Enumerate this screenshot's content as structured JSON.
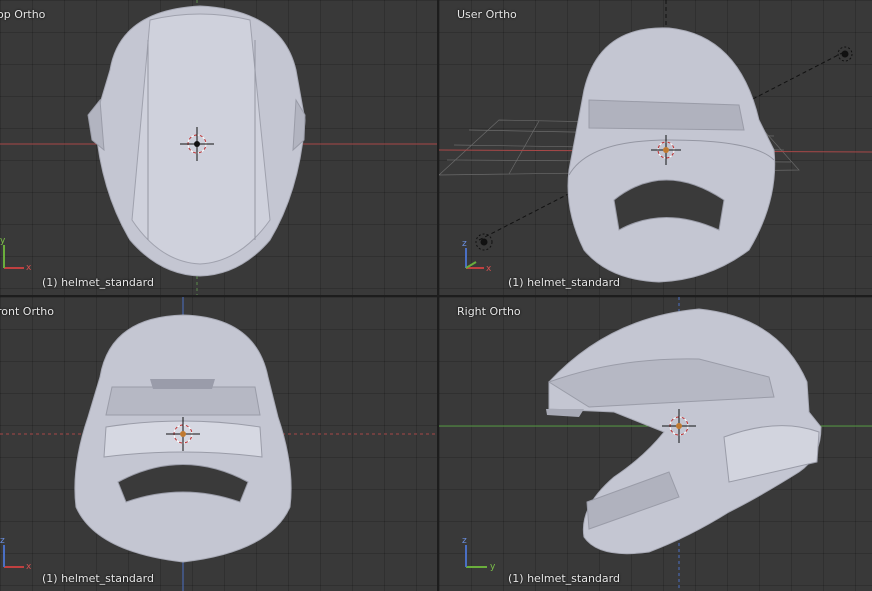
{
  "viewports": {
    "top": {
      "title": "op Ortho",
      "object": "(1) helmet_standard"
    },
    "user": {
      "title": "User Ortho",
      "object": "(1) helmet_standard"
    },
    "front": {
      "title": "ront Ortho",
      "object": "(1) helmet_standard"
    },
    "right": {
      "title": "Right Ortho",
      "object": "(1) helmet_standard"
    }
  },
  "axes": {
    "x": "x",
    "y": "y",
    "z": "z"
  },
  "colors": {
    "background": "#393939",
    "mesh": "#c4c6d2",
    "x_axis": "#b34a4a",
    "y_axis": "#6aae3c",
    "z_axis": "#4a6fc4"
  }
}
